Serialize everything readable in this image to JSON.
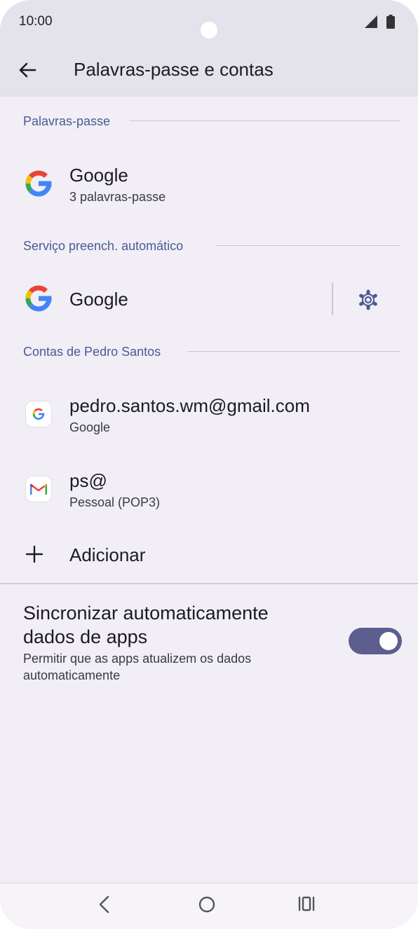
{
  "status_bar": {
    "time": "10:00"
  },
  "app_bar": {
    "title": "Palavras-passe e contas"
  },
  "sections": {
    "passwords": {
      "header": "Palavras-passe",
      "item": {
        "title": "Google",
        "subtitle": "3 palavras-passe",
        "icon": "google-g-icon"
      }
    },
    "autofill": {
      "header": "Serviço preench. automático",
      "item": {
        "title": "Google",
        "icon": "google-g-icon",
        "settings_icon": "gear-icon"
      }
    },
    "accounts": {
      "header": "Contas de Pedro Santos",
      "items": [
        {
          "title": "pedro.santos.wm@gmail.com",
          "subtitle": "Google",
          "icon": "google-account-icon"
        },
        {
          "title": "ps@",
          "subtitle": "Pessoal (POP3)",
          "icon": "gmail-icon"
        }
      ],
      "add_label": "Adicionar"
    }
  },
  "sync": {
    "title": "Sincronizar automaticamente dados de apps",
    "subtitle": "Permitir que as apps atualizem os dados automaticamente",
    "enabled": true
  },
  "colors": {
    "accent": "#5b5e8e",
    "section_header": "#4b5a95",
    "background": "#f1eef6",
    "app_bar": "#e4e2ea"
  }
}
